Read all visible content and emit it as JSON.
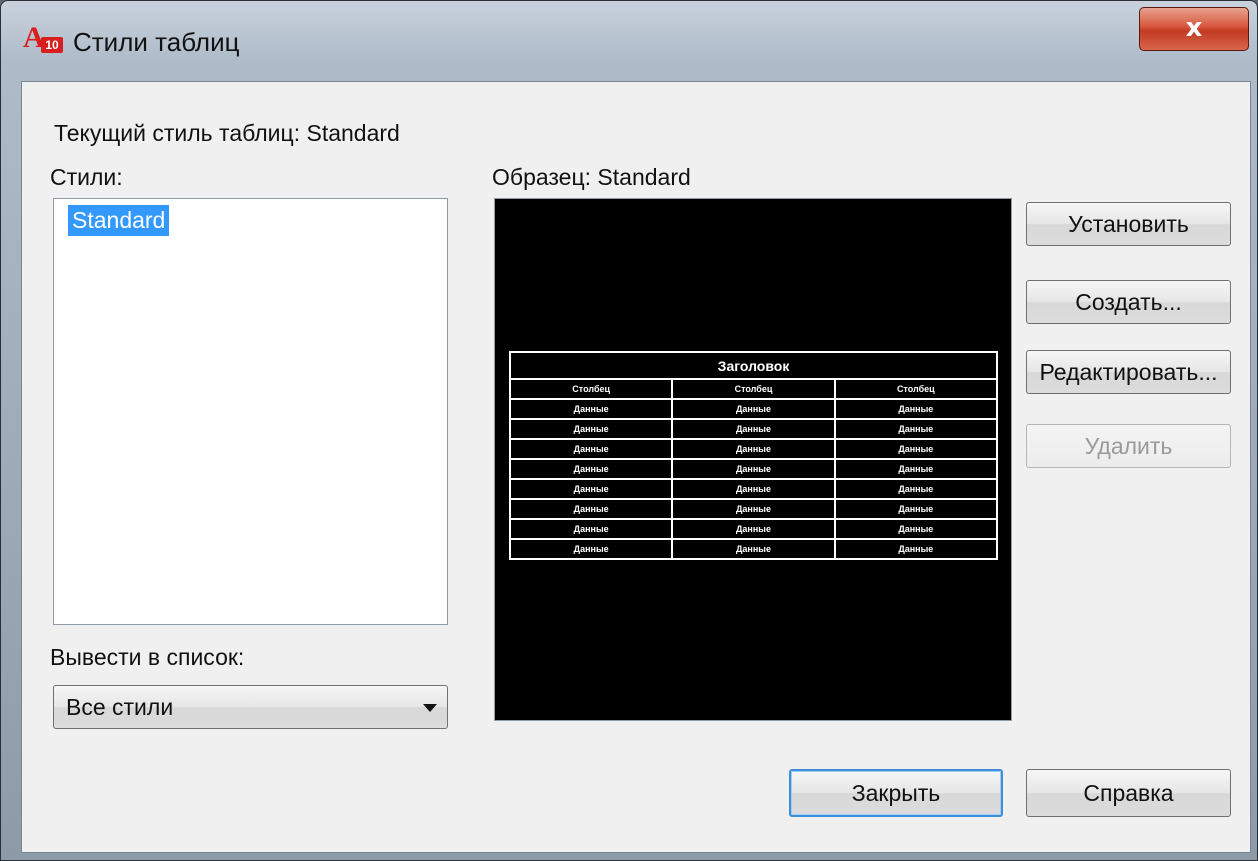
{
  "window": {
    "title": "Стили таблиц",
    "app_icon_letter": "A",
    "app_icon_badge": "10",
    "close_glyph": "x"
  },
  "current_style": "Текущий стиль таблиц: Standard",
  "styles": {
    "label": "Стили:",
    "items": [
      "Standard"
    ],
    "selected": "Standard"
  },
  "preview": {
    "label": "Образец: Standard",
    "table": {
      "title": "Заголовок",
      "columns": [
        "Столбец",
        "Столбец",
        "Столбец"
      ],
      "rows": [
        [
          "Данные",
          "Данные",
          "Данные"
        ],
        [
          "Данные",
          "Данные",
          "Данные"
        ],
        [
          "Данные",
          "Данные",
          "Данные"
        ],
        [
          "Данные",
          "Данные",
          "Данные"
        ],
        [
          "Данные",
          "Данные",
          "Данные"
        ],
        [
          "Данные",
          "Данные",
          "Данные"
        ],
        [
          "Данные",
          "Данные",
          "Данные"
        ],
        [
          "Данные",
          "Данные",
          "Данные"
        ]
      ]
    }
  },
  "buttons": {
    "set_current": "Установить",
    "new": "Создать...",
    "modify": "Редактировать...",
    "delete": "Удалить",
    "close": "Закрыть",
    "help": "Справка"
  },
  "list_filter": {
    "label": "Вывести в список:",
    "value": "Все стили"
  },
  "colors": {
    "selection": "#3399ff",
    "preview_background": "#000000",
    "close_button": "#c9442b"
  }
}
